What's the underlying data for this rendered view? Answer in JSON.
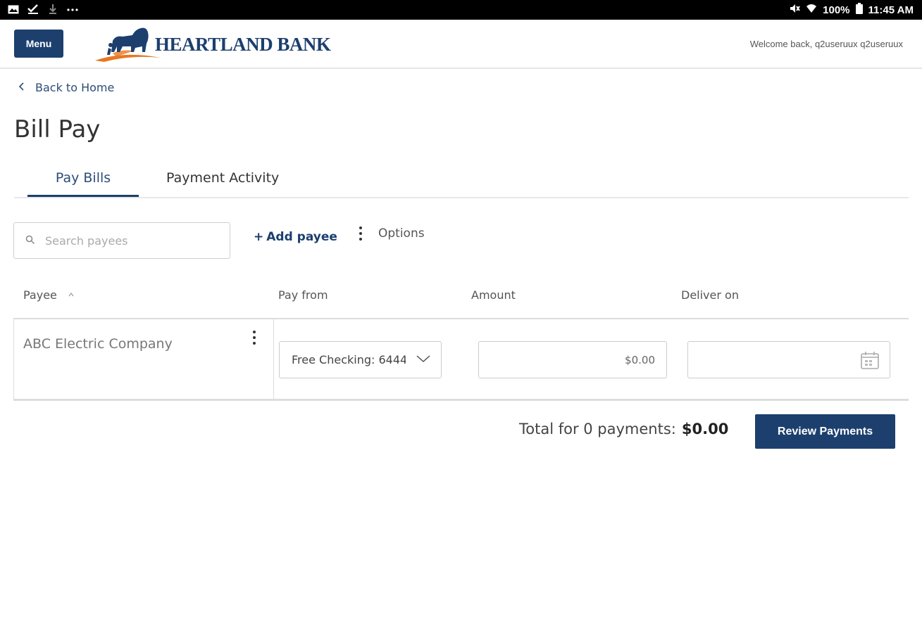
{
  "status_bar": {
    "time": "11:45 AM",
    "battery": "100%",
    "left_icons": [
      "gallery-icon",
      "check-icon",
      "download-icon",
      "more-dots-icon"
    ],
    "right_icons": [
      "mute-icon",
      "wifi-icon",
      "battery-icon"
    ]
  },
  "header": {
    "menu_label": "Menu",
    "bank_name": "HEARTLAND BANK",
    "welcome_text": "Welcome back, q2useruux q2useruux"
  },
  "nav": {
    "back_label": "Back to Home"
  },
  "page": {
    "title": "Bill Pay"
  },
  "tabs": [
    {
      "label": "Pay Bills",
      "active": true
    },
    {
      "label": "Payment Activity",
      "active": false
    }
  ],
  "toolbar": {
    "search_placeholder": "Search payees",
    "add_payee_label": "Add payee",
    "options_label": "Options"
  },
  "table": {
    "columns": [
      "Payee",
      "Pay from",
      "Amount",
      "Deliver on"
    ],
    "rows": [
      {
        "payee": "ABC Electric Company",
        "pay_from": "Free Checking: 6444",
        "amount_placeholder": "$0.00",
        "deliver_on": ""
      }
    ]
  },
  "footer": {
    "total_label": "Total for 0 payments:",
    "total_amount": "$0.00",
    "review_label": "Review Payments"
  },
  "colors": {
    "brand": "#1c3f6e",
    "accent_orange": "#e87722"
  }
}
